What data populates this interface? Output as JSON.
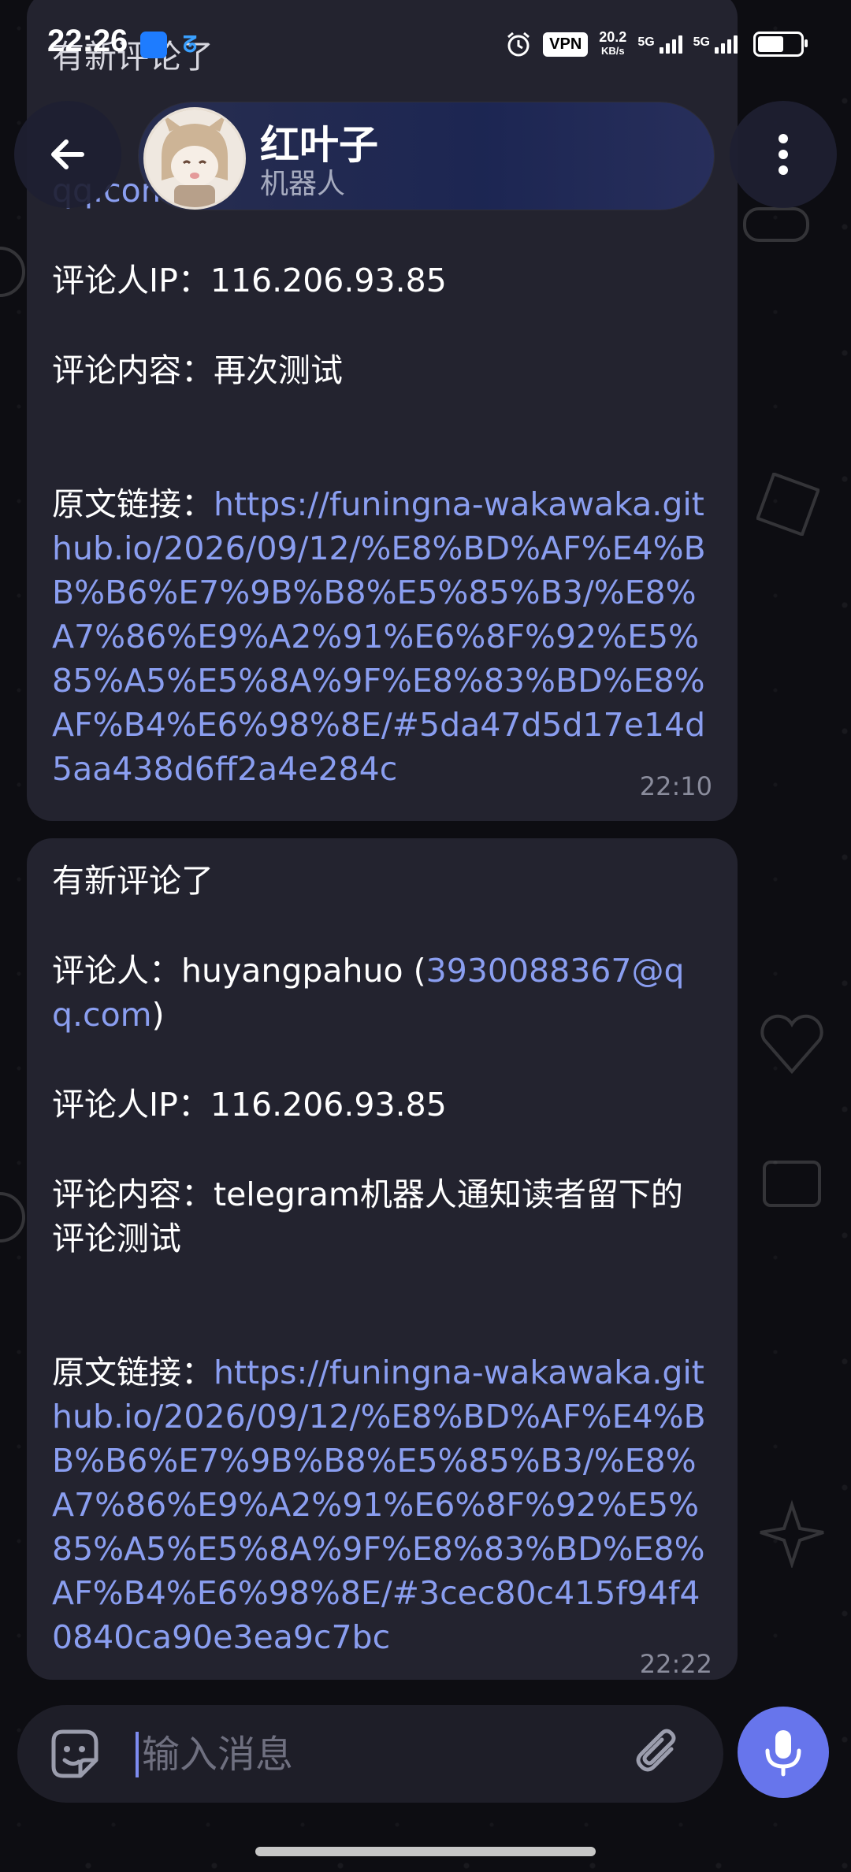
{
  "status_bar": {
    "time": "22:26",
    "vpn": "VPN",
    "speed_value": "20.2",
    "speed_unit": "KB/s",
    "net1": "5G",
    "net2": "5G"
  },
  "header": {
    "title": "红叶子",
    "subtitle": "机器人",
    "icons": {
      "back": "arrow-left-icon",
      "menu": "more-vertical-icon"
    }
  },
  "messages": [
    {
      "top_partial": "有新评论了",
      "line_partial_email": "qq.com)",
      "ip_label": "评论人IP：",
      "ip": "116.206.93.85",
      "content_label": "评论内容：",
      "content": "再次测试",
      "link_label": "原文链接：",
      "link": "https://funingna-wakawaka.github.io/2026/09/12/%E8%BD%AF%E4%BB%B6%E7%9B%B8%E5%85%B3/%E8%A7%86%E9%A2%91%E6%8F%92%E5%85%A5%E5%8A%9F%E8%83%BD%E8%AF%B4%E6%98%8E/#5da47d5d17e14d5aa438d6ff2a4e284c",
      "time": "22:10"
    },
    {
      "header": "有新评论了",
      "commenter_label": "评论人：",
      "commenter": "huyangpahuo (",
      "email": "3930088367@qq.com",
      "email_close": ")",
      "ip_label": "评论人IP：",
      "ip": "116.206.93.85",
      "content_label": "评论内容：",
      "content": "telegram机器人通知读者留下的评论测试",
      "link_label": "原文链接：",
      "link": "https://funingna-wakawaka.github.io/2026/09/12/%E8%BD%AF%E4%BB%B6%E7%9B%B8%E5%85%B3/%E8%A7%86%E9%A2%91%E6%8F%92%E5%85%A5%E5%8A%9F%E8%83%BD%E8%AF%B4%E6%98%8E/#3cec80c415f94f40840ca90e3ea9c7bc",
      "time": "22:22"
    }
  ],
  "composer": {
    "placeholder": "输入消息",
    "icons": {
      "emoji": "sticker-icon",
      "attach": "paperclip-icon",
      "mic": "microphone-icon"
    }
  },
  "colors": {
    "accent": "#6775ec",
    "link": "#8a9ef0",
    "bubble": "#23232f"
  }
}
